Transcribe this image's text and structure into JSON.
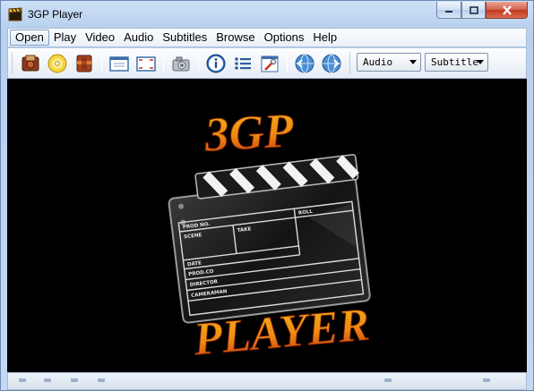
{
  "window": {
    "title": "3GP Player",
    "app_icon": "clapperboard-icon"
  },
  "title_buttons": {
    "minimize_icon": "minimize-icon",
    "maximize_icon": "maximize-icon",
    "close_icon": "close-icon"
  },
  "menu": {
    "items": [
      {
        "label": "Open",
        "active": true
      },
      {
        "label": "Play"
      },
      {
        "label": "Video"
      },
      {
        "label": "Audio"
      },
      {
        "label": "Subtitles"
      },
      {
        "label": "Browse"
      },
      {
        "label": "Options"
      },
      {
        "label": "Help"
      }
    ]
  },
  "toolbar": {
    "buttons": [
      {
        "icon": "open-file-icon"
      },
      {
        "icon": "open-disc-icon"
      },
      {
        "icon": "open-url-icon"
      },
      {
        "icon": "window-mode-icon"
      },
      {
        "icon": "fullscreen-icon"
      },
      {
        "icon": "snapshot-icon"
      },
      {
        "icon": "info-icon"
      },
      {
        "icon": "playlist-icon"
      },
      {
        "icon": "settings-icon"
      },
      {
        "icon": "globe-left-icon"
      },
      {
        "icon": "globe-right-icon"
      }
    ],
    "audio_label": "Audio",
    "subtitle_label": "Subtitle"
  },
  "logo": {
    "top_text": "3GP",
    "bottom_text": "PLAYER",
    "slate_labels": [
      "PROD NO.",
      "SCENE",
      "TAKE",
      "ROLL",
      "DATE",
      "PROD.CO",
      "DIRECTOR",
      "CAMERAMAN"
    ]
  },
  "colors": {
    "video_background": "#000000",
    "logo_orange": "#f29a12",
    "logo_red": "#c8360c"
  }
}
